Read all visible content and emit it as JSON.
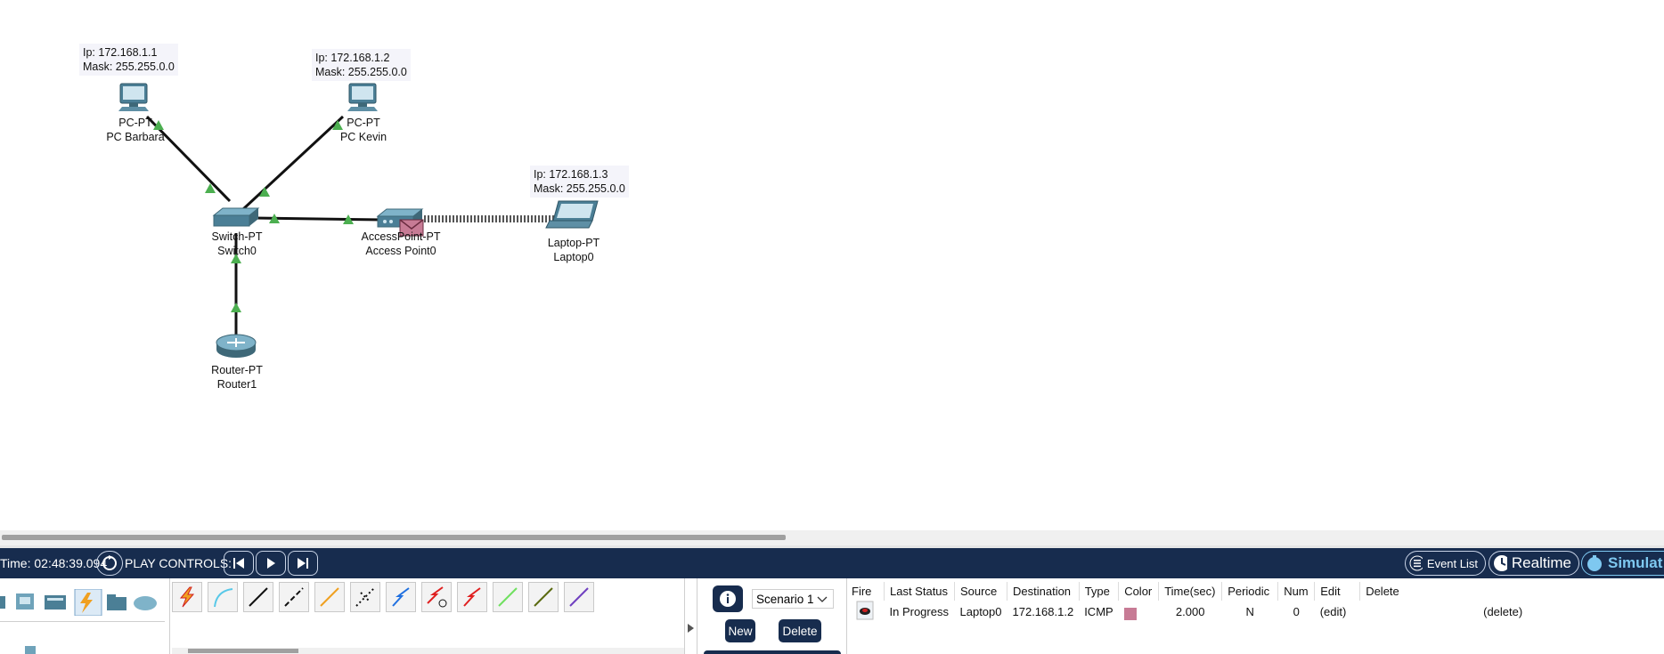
{
  "devices": {
    "pc_barbara": {
      "type": "PC-PT",
      "name": "PC Barbara",
      "ip": "Ip: 172.168.1.1",
      "mask": "Mask: 255.255.0.0"
    },
    "pc_kevin": {
      "type": "PC-PT",
      "name": "PC Kevin",
      "ip": "Ip: 172.168.1.2",
      "mask": "Mask: 255.255.0.0"
    },
    "laptop0": {
      "type": "Laptop-PT",
      "name": "Laptop0",
      "ip": "Ip: 172.168.1.3",
      "mask": "Mask: 255.255.0.0"
    },
    "switch0": {
      "type": "Switch-PT",
      "name": "Switch0"
    },
    "access_point0": {
      "type": "AccessPoint-PT",
      "name": "Access Point0"
    },
    "router1": {
      "type": "Router-PT",
      "name": "Router1"
    }
  },
  "toolbar": {
    "time_label": "Time: 02:48:39.094",
    "play_controls_label": "PLAY CONTROLS:",
    "event_list_label": "Event List",
    "realtime_label": "Realtime",
    "simulation_label": "Simulat"
  },
  "scenario": {
    "selected": "Scenario 1",
    "new_label": "New",
    "delete_label": "Delete"
  },
  "event_table": {
    "headers": [
      "Fire",
      "Last Status",
      "Source",
      "Destination",
      "Type",
      "Color",
      "Time(sec)",
      "Periodic",
      "Num",
      "Edit",
      "Delete"
    ],
    "rows": [
      {
        "last_status": "In Progress",
        "source": "Laptop0",
        "destination": "172.168.1.2",
        "type": "ICMP",
        "color": "#c77b95",
        "time": "2.000",
        "periodic": "N",
        "num": "0",
        "edit": "(edit)",
        "delete": "(delete)"
      }
    ]
  },
  "colors": {
    "toolbar_bg": "#172c4e",
    "link_up": "#4caf50",
    "pdu_color": "#c77b95"
  },
  "icons": {
    "devices": [
      "pc-icon",
      "laptop-icon",
      "switch-icon",
      "access-point-icon",
      "router-icon",
      "envelope-icon"
    ],
    "connections": [
      "lightning-icon",
      "console-cable-icon",
      "copper-straight-icon",
      "copper-cross-icon",
      "fiber-icon",
      "phone-cable-icon",
      "coaxial-icon",
      "serial-dce-icon",
      "serial-dte-icon",
      "octal-cable-icon",
      "iot-cable-icon",
      "usb-cable-icon"
    ]
  }
}
